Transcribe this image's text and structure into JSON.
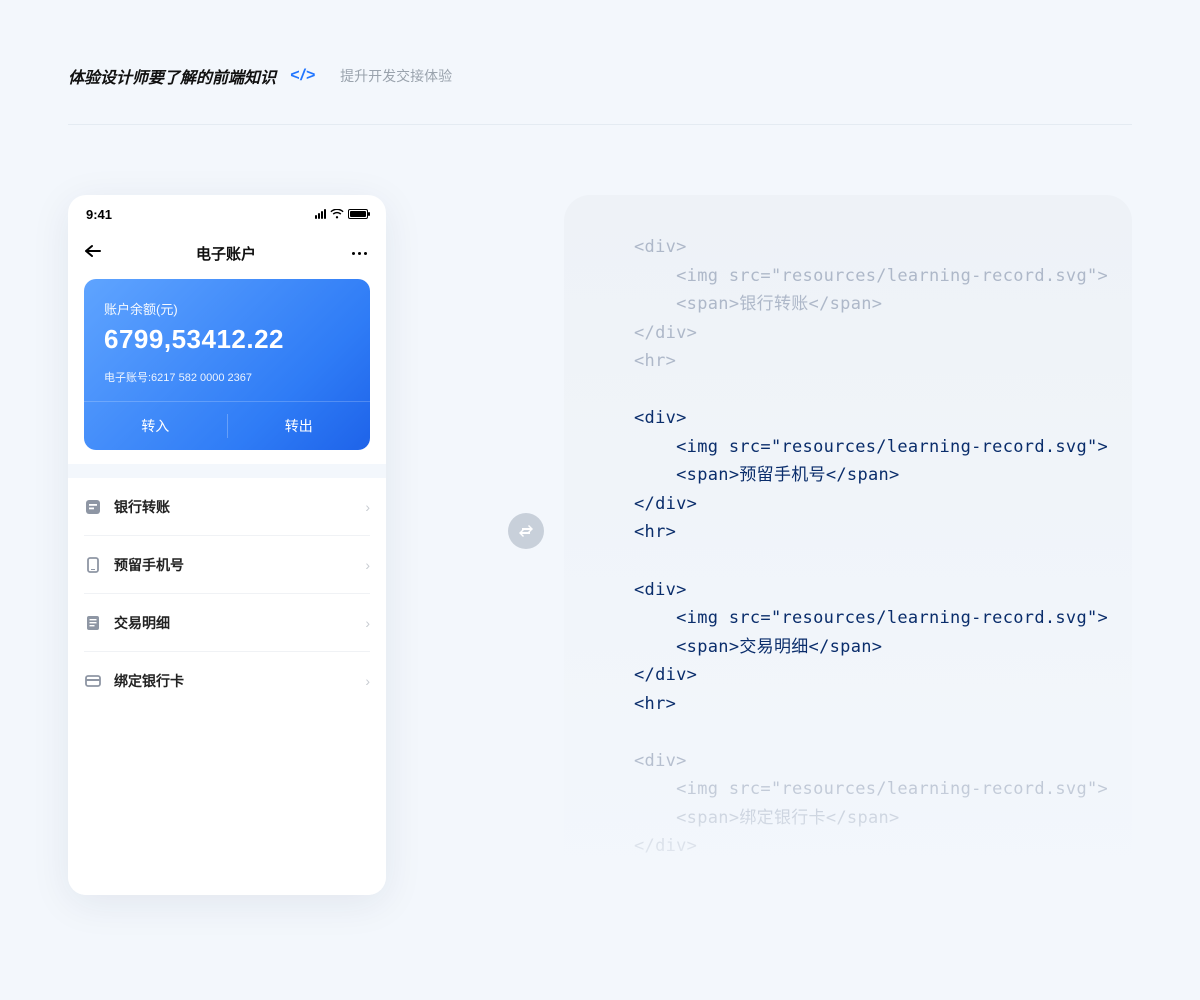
{
  "header": {
    "title": "体验设计师要了解的前端知识",
    "code_mark": "</>",
    "subtitle": "提升开发交接体验"
  },
  "phone": {
    "status_time": "9:41",
    "nav_title": "电子账户",
    "card": {
      "balance_label": "账户余额(元)",
      "balance_amount": "6799,53412.22",
      "account_no": "电子账号:6217 582 0000 2367",
      "action_in": "转入",
      "action_out": "转出"
    },
    "menu": [
      {
        "label": "银行转账"
      },
      {
        "label": "预留手机号"
      },
      {
        "label": "交易明细"
      },
      {
        "label": "绑定银行卡"
      }
    ]
  },
  "code": {
    "block0": "<div>\n    <img src=\"resources/learning-record.svg\">\n    <span>银行转账</span>\n</div>\n<hr>",
    "block1": "<div>\n    <img src=\"resources/learning-record.svg\">\n    <span>预留手机号</span>\n</div>\n<hr>",
    "block2": "<div>\n    <img src=\"resources/learning-record.svg\">\n    <span>交易明细</span>\n</div>\n<hr>",
    "block3": "<div>\n    <img src=\"resources/learning-record.svg\">\n    <span>绑定银行卡</span>\n</div>"
  }
}
